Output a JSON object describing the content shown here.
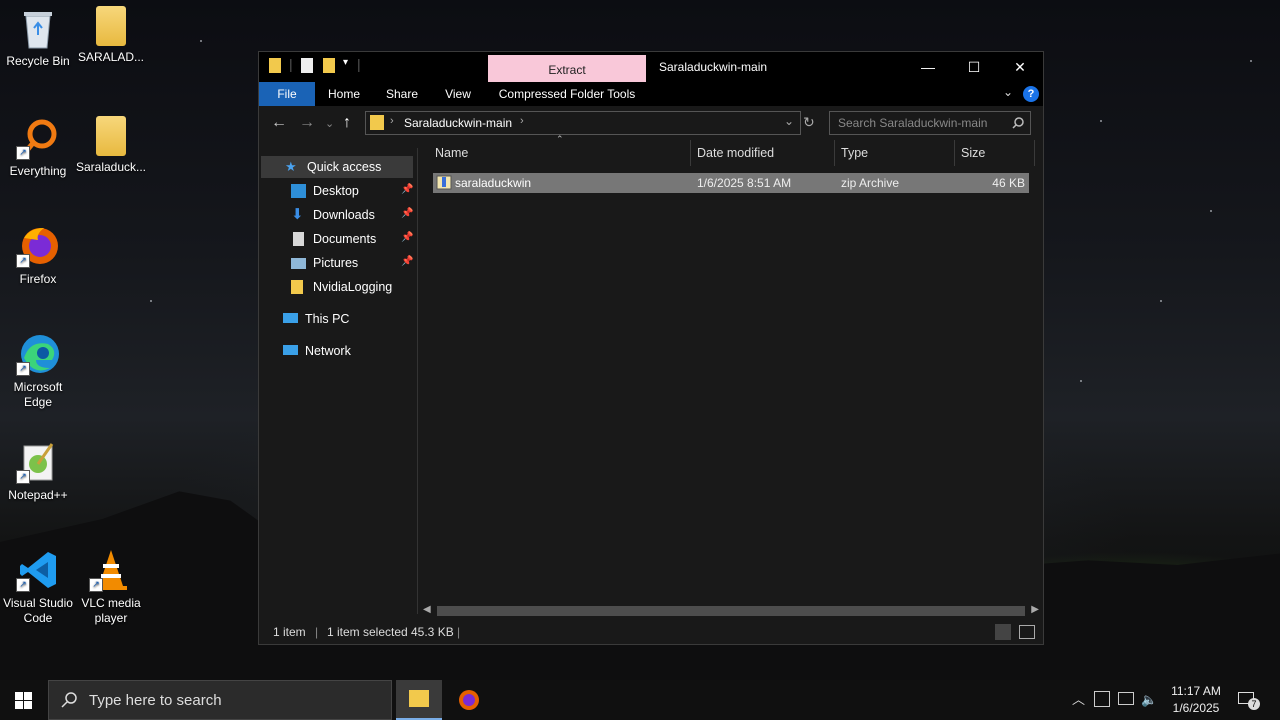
{
  "desktop": {
    "icons": [
      {
        "label": "Recycle Bin"
      },
      {
        "label": "SARALAD..."
      },
      {
        "label": "Everything"
      },
      {
        "label": "Saraladuck..."
      },
      {
        "label": "Firefox"
      },
      {
        "label": "Microsoft Edge"
      },
      {
        "label": "Notepad++"
      },
      {
        "label": "Visual Studio Code"
      },
      {
        "label": "VLC media player"
      }
    ]
  },
  "window": {
    "title": "Saraladuckwin-main",
    "contextual_tab": "Extract",
    "controls": {
      "minimize": "—",
      "maximize": "☐",
      "close": "✕"
    }
  },
  "ribbon": {
    "tabs": [
      "File",
      "Home",
      "Share",
      "View",
      "Compressed Folder Tools"
    ],
    "help": "?"
  },
  "address": {
    "path": "Saraladuckwin-main",
    "search_placeholder": "Search Saraladuckwin-main"
  },
  "nav_pane": {
    "quick_access": "Quick access",
    "items": [
      "Desktop",
      "Downloads",
      "Documents",
      "Pictures",
      "NvidiaLogging"
    ],
    "this_pc": "This PC",
    "network": "Network"
  },
  "columns": [
    "Name",
    "Date modified",
    "Type",
    "Size"
  ],
  "files": [
    {
      "name": "saraladuckwin",
      "date": "1/6/2025 8:51 AM",
      "type": "zip Archive",
      "size": "46 KB"
    }
  ],
  "status": {
    "count": "1 item",
    "selected": "1 item selected",
    "size": "45.3 KB"
  },
  "taskbar": {
    "search_placeholder": "Type here to search",
    "time": "11:17 AM",
    "date": "1/6/2025",
    "notifications": "7"
  },
  "colors": {
    "accent": "#1a63b6",
    "extract_tab": "#f9c8d9",
    "selection": "#777777"
  }
}
